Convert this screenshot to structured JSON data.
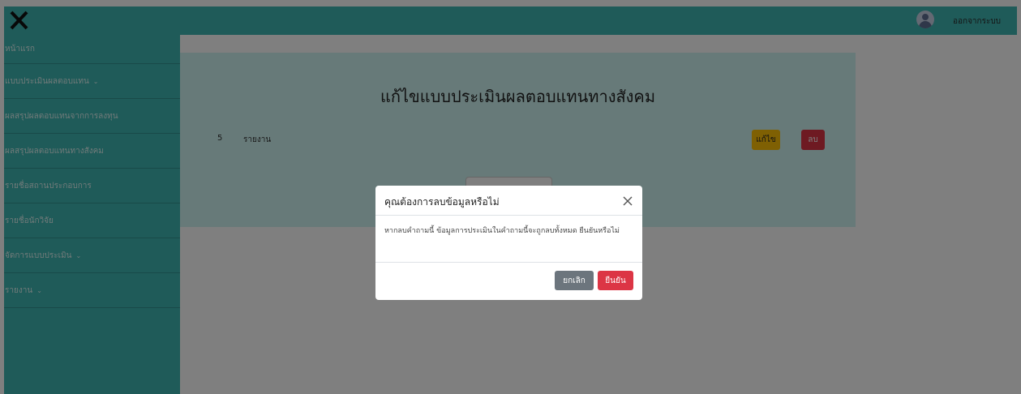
{
  "colors": {
    "teal": "#3fb6b2",
    "card_bg": "#cff4f2",
    "warning": "#ffc107",
    "danger": "#dc3545",
    "secondary": "#6c757d"
  },
  "header": {
    "menu_icon": "close-icon",
    "avatar_icon": "user-avatar-icon",
    "logout_label": "ออกจากระบบ"
  },
  "sidebar": {
    "items": [
      {
        "label": "หน้าแรก",
        "caret": ""
      },
      {
        "label": "แบบประเมินผลตอบแทน",
        "caret": "⌄"
      },
      {
        "label": "ผลสรุปผลตอบแทนจากการลงทุน",
        "caret": ""
      },
      {
        "label": "ผลสรุปผลตอบแทนทางสังคม",
        "caret": ""
      },
      {
        "label": "รายชื่อสถานประกอบการ",
        "caret": ""
      },
      {
        "label": "รายชื่อนักวิจัย",
        "caret": ""
      },
      {
        "label": "จัดการแบบประเมิน",
        "caret": "⌄"
      },
      {
        "label": "รายงาน",
        "caret": "⌄"
      }
    ]
  },
  "main": {
    "title": "แก้ไขแบบประเมินผลตอบแทนทางสังคม",
    "row": {
      "number": "5",
      "name": "รายงาน"
    },
    "edit_label": "แก้ไข",
    "delete_label": "ลบ"
  },
  "modal": {
    "title": "คุณต้องการลบข้อมูลหรือไม่",
    "body": "หากลบคำถามนี้ ข้อมูลการประเมินในคำถามนี้จะถูกลบทั้งหมด ยืนยันหรือไม่",
    "cancel_label": "ยกเลิก",
    "confirm_label": "ยืนยัน"
  }
}
